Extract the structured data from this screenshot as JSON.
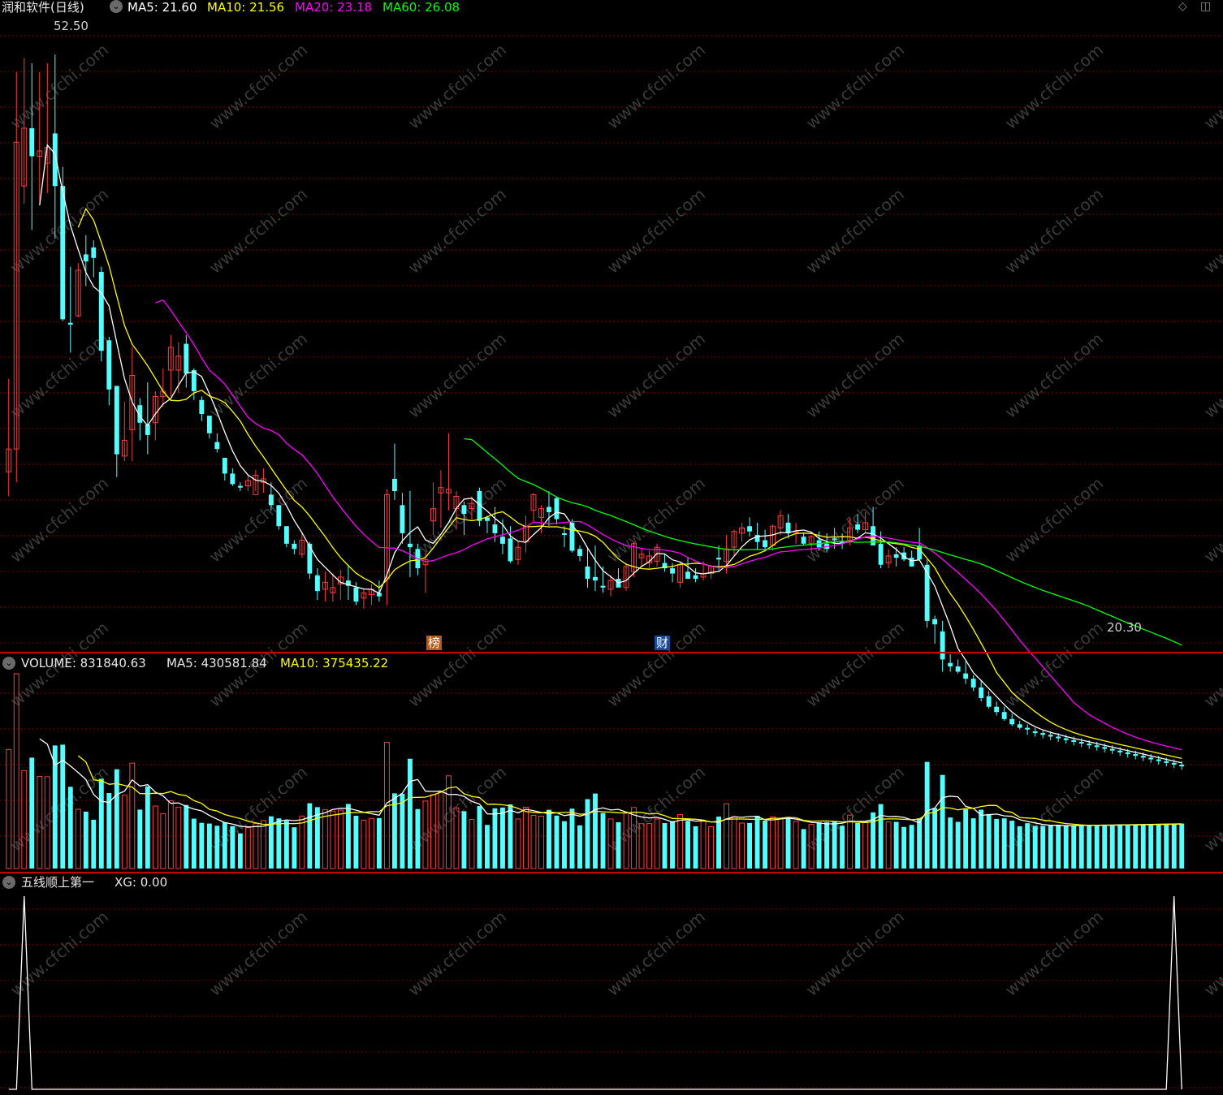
{
  "header": {
    "stock_name": "润和软件(日线)",
    "ma5": "MA5: 21.60",
    "ma10": "MA10: 21.56",
    "ma20": "MA20: 23.18",
    "ma60": "MA60: 26.08"
  },
  "volume_header": {
    "volume": "VOLUME: 831840.63",
    "ma5": "MA5: 430581.84",
    "ma10": "MA10: 375435.22"
  },
  "indicator_header": {
    "name": "五线顺上第一",
    "xg": "XG: 0.00"
  },
  "annotations": {
    "high_label": "52.50",
    "low_label": "20.30",
    "badge_bang": "榜",
    "badge_cai": "财"
  },
  "watermark": "www.cfchi.com",
  "colors": {
    "up": "#ff3c3c",
    "down": "#54ffff",
    "ma5": "#ffffff",
    "ma10": "#ffff00",
    "ma20": "#ff00ff",
    "ma60": "#00ff00",
    "grid": "#7a0000",
    "panel_border": "#c80000"
  },
  "icons": {
    "collapse": "chevron-down-circle-icon",
    "corner_left": "diamond-icon",
    "corner_right": "window-icon"
  },
  "chart_data": {
    "type": "candlestick",
    "price_range": [
      19.5,
      54.5
    ],
    "volume_range": [
      0,
      1050000
    ],
    "indicator_range": [
      0,
      1
    ],
    "candles": [
      {
        "o": 28.7,
        "h": 34,
        "l": 27.3,
        "c": 30
      },
      {
        "o": 30,
        "h": 51.5,
        "l": 28.1,
        "c": 47.5
      },
      {
        "o": 45,
        "h": 52.3,
        "l": 44,
        "c": 48.3
      },
      {
        "o": 48.3,
        "h": 52,
        "l": 42.5,
        "c": 46.7
      },
      {
        "o": 46.7,
        "h": 51.5,
        "l": 44.1,
        "c": 47
      },
      {
        "o": 46.3,
        "h": 52,
        "l": 44.6,
        "c": 47.2
      },
      {
        "o": 48,
        "h": 52.5,
        "l": 42,
        "c": 45
      },
      {
        "o": 45,
        "h": 46.1,
        "l": 37.3,
        "c": 37.4
      },
      {
        "o": 37.2,
        "h": 40.4,
        "l": 35.5,
        "c": 37.1
      },
      {
        "o": 37.6,
        "h": 40.6,
        "l": 37.5,
        "c": 40.2
      },
      {
        "o": 41.1,
        "h": 42.2,
        "l": 39.3,
        "c": 40.7
      },
      {
        "o": 41.5,
        "h": 41.9,
        "l": 39.8,
        "c": 40.9
      },
      {
        "o": 40.1,
        "h": 40.4,
        "l": 35,
        "c": 35.6
      },
      {
        "o": 36.2,
        "h": 36.4,
        "l": 32.5,
        "c": 33.4
      },
      {
        "o": 33.6,
        "h": 33.6,
        "l": 28.4,
        "c": 29.7
      },
      {
        "o": 29.6,
        "h": 32.7,
        "l": 29.3,
        "c": 30.5
      },
      {
        "o": 31.1,
        "h": 35.8,
        "l": 29.3,
        "c": 34.2
      },
      {
        "o": 32.5,
        "h": 32.9,
        "l": 30.5,
        "c": 31.5
      },
      {
        "o": 31.4,
        "h": 33.8,
        "l": 29.7,
        "c": 30.8
      },
      {
        "o": 31.5,
        "h": 33.3,
        "l": 30.5,
        "c": 33
      },
      {
        "o": 33,
        "h": 34.6,
        "l": 32.4,
        "c": 33.3
      },
      {
        "o": 34.5,
        "h": 36.5,
        "l": 33,
        "c": 35.8
      },
      {
        "o": 34.5,
        "h": 36.1,
        "l": 33.2,
        "c": 35.3
      },
      {
        "o": 36,
        "h": 36.5,
        "l": 33.5,
        "c": 34.3
      },
      {
        "o": 34.5,
        "h": 34.6,
        "l": 32.8,
        "c": 33.3
      },
      {
        "o": 32.8,
        "h": 33,
        "l": 31.6,
        "c": 32
      },
      {
        "o": 31.9,
        "h": 31.9,
        "l": 30.6,
        "c": 30.9
      },
      {
        "o": 30.4,
        "h": 30.9,
        "l": 29.8,
        "c": 30
      },
      {
        "o": 29.5,
        "h": 29.5,
        "l": 28.2,
        "c": 28.6
      },
      {
        "o": 28.6,
        "h": 28.9,
        "l": 27.9,
        "c": 28
      },
      {
        "o": 27.9,
        "h": 28.1,
        "l": 27.6,
        "c": 27.8
      },
      {
        "o": 27.9,
        "h": 28.5,
        "l": 27.6,
        "c": 28.2
      },
      {
        "o": 27.4,
        "h": 28.8,
        "l": 27.6,
        "c": 28.5
      },
      {
        "o": 28.1,
        "h": 28.9,
        "l": 27.5,
        "c": 28.3
      },
      {
        "o": 27.4,
        "h": 28.1,
        "l": 26.5,
        "c": 26.8
      },
      {
        "o": 26.8,
        "h": 26.8,
        "l": 25.4,
        "c": 25.6
      },
      {
        "o": 25.6,
        "h": 25.6,
        "l": 24.4,
        "c": 24.6
      },
      {
        "o": 24.6,
        "h": 24.8,
        "l": 24,
        "c": 24.3
      },
      {
        "o": 24,
        "h": 25.3,
        "l": 23.8,
        "c": 24.8
      },
      {
        "o": 24.6,
        "h": 24.7,
        "l": 22.6,
        "c": 22.9
      },
      {
        "o": 22.8,
        "h": 23.2,
        "l": 21.4,
        "c": 21.9
      },
      {
        "o": 22,
        "h": 23,
        "l": 21.3,
        "c": 22.4
      },
      {
        "o": 21.8,
        "h": 22.9,
        "l": 21.3,
        "c": 22.1
      },
      {
        "o": 22.3,
        "h": 23.1,
        "l": 21.4,
        "c": 22.7
      },
      {
        "o": 22.5,
        "h": 23.4,
        "l": 21.4,
        "c": 22.2
      },
      {
        "o": 22.1,
        "h": 22.4,
        "l": 21.1,
        "c": 21.3
      },
      {
        "o": 21.5,
        "h": 22,
        "l": 20.9,
        "c": 21.8
      },
      {
        "o": 21.7,
        "h": 22.3,
        "l": 21.1,
        "c": 22
      },
      {
        "o": 21.8,
        "h": 22.5,
        "l": 21.3,
        "c": 21.6
      },
      {
        "o": 22.6,
        "h": 27.7,
        "l": 21.1,
        "c": 27.4
      },
      {
        "o": 28.3,
        "h": 30.3,
        "l": 27.1,
        "c": 27.6
      },
      {
        "o": 26.8,
        "h": 27.5,
        "l": 24.6,
        "c": 25.2
      },
      {
        "o": 24.6,
        "h": 27.6,
        "l": 22.7,
        "c": 24.4
      },
      {
        "o": 24.3,
        "h": 24.6,
        "l": 22.8,
        "c": 23.2
      },
      {
        "o": 23.4,
        "h": 24.1,
        "l": 21.8,
        "c": 23.7
      },
      {
        "o": 25.9,
        "h": 28.1,
        "l": 25.1,
        "c": 26.6
      },
      {
        "o": 27.5,
        "h": 28.8,
        "l": 25.5,
        "c": 27.8
      },
      {
        "o": 27.5,
        "h": 30.9,
        "l": 26.5,
        "c": 27.7
      },
      {
        "o": 26.6,
        "h": 27.6,
        "l": 25.4,
        "c": 27.3
      },
      {
        "o": 26.8,
        "h": 27,
        "l": 25.1,
        "c": 26.3
      },
      {
        "o": 26.6,
        "h": 27.3,
        "l": 25.9,
        "c": 26.9
      },
      {
        "o": 27.6,
        "h": 27.8,
        "l": 25.6,
        "c": 25.9
      },
      {
        "o": 26.1,
        "h": 26.2,
        "l": 25.2,
        "c": 25.9
      },
      {
        "o": 25.7,
        "h": 26.7,
        "l": 24.7,
        "c": 25.2
      },
      {
        "o": 25,
        "h": 26,
        "l": 24,
        "c": 24.6
      },
      {
        "o": 24.9,
        "h": 25.6,
        "l": 23.5,
        "c": 23.6
      },
      {
        "o": 23.7,
        "h": 24.7,
        "l": 23.4,
        "c": 24.4
      },
      {
        "o": 24.7,
        "h": 26.2,
        "l": 24.1,
        "c": 25.6
      },
      {
        "o": 26.5,
        "h": 27.5,
        "l": 25.8,
        "c": 27.4
      },
      {
        "o": 26.1,
        "h": 26.8,
        "l": 25.2,
        "c": 26.6
      },
      {
        "o": 26.7,
        "h": 27.6,
        "l": 25.6,
        "c": 26.4
      },
      {
        "o": 27.2,
        "h": 27.3,
        "l": 25.7,
        "c": 26
      },
      {
        "o": 25.2,
        "h": 25.6,
        "l": 24.4,
        "c": 25.1
      },
      {
        "o": 25.8,
        "h": 26,
        "l": 24.1,
        "c": 24.2
      },
      {
        "o": 24.3,
        "h": 24.5,
        "l": 23.6,
        "c": 23.9
      },
      {
        "o": 23.3,
        "h": 24.4,
        "l": 22.1,
        "c": 22.6
      },
      {
        "o": 22.7,
        "h": 24.5,
        "l": 21.9,
        "c": 22.5
      },
      {
        "o": 22.2,
        "h": 23.3,
        "l": 21.8,
        "c": 22.1
      },
      {
        "o": 22,
        "h": 22.8,
        "l": 21.6,
        "c": 22.5
      },
      {
        "o": 22.6,
        "h": 23.2,
        "l": 22.2,
        "c": 22.1
      },
      {
        "o": 22.1,
        "h": 23.5,
        "l": 21.9,
        "c": 23.3
      },
      {
        "o": 23,
        "h": 24.7,
        "l": 22.7,
        "c": 24.6
      },
      {
        "o": 23.8,
        "h": 24.3,
        "l": 23.3,
        "c": 24
      },
      {
        "o": 23.5,
        "h": 24.2,
        "l": 23.2,
        "c": 23.9
      },
      {
        "o": 23.6,
        "h": 24.6,
        "l": 23.3,
        "c": 24.4
      },
      {
        "o": 23.5,
        "h": 24,
        "l": 23,
        "c": 23.2
      },
      {
        "o": 23.2,
        "h": 23.5,
        "l": 22.4,
        "c": 22.9
      },
      {
        "o": 22.4,
        "h": 23.6,
        "l": 22.1,
        "c": 23.4
      },
      {
        "o": 23,
        "h": 23.8,
        "l": 22.7,
        "c": 22.6
      },
      {
        "o": 22.8,
        "h": 23.2,
        "l": 22.4,
        "c": 22.6
      },
      {
        "o": 22.7,
        "h": 23.6,
        "l": 22.5,
        "c": 22.9
      },
      {
        "o": 22.9,
        "h": 23.4,
        "l": 22.6,
        "c": 23.3
      },
      {
        "o": 23.8,
        "h": 24.5,
        "l": 23.1,
        "c": 23.7
      },
      {
        "o": 23.6,
        "h": 25.1,
        "l": 22.9,
        "c": 24.3
      },
      {
        "o": 24.4,
        "h": 25.4,
        "l": 23.9,
        "c": 25.3
      },
      {
        "o": 25.2,
        "h": 25.8,
        "l": 24.7,
        "c": 25.5
      },
      {
        "o": 25.6,
        "h": 26.1,
        "l": 25,
        "c": 25.3
      },
      {
        "o": 25.1,
        "h": 25.8,
        "l": 24.3,
        "c": 24.7
      },
      {
        "o": 24.8,
        "h": 25.4,
        "l": 24.2,
        "c": 24.4
      },
      {
        "o": 24.5,
        "h": 25.7,
        "l": 24.2,
        "c": 25.6
      },
      {
        "o": 25.5,
        "h": 26.5,
        "l": 25.1,
        "c": 26.2
      },
      {
        "o": 25.8,
        "h": 26.3,
        "l": 24.9,
        "c": 25.2
      },
      {
        "o": 25.3,
        "h": 25.8,
        "l": 24.6,
        "c": 25.3
      },
      {
        "o": 25,
        "h": 25.2,
        "l": 24.5,
        "c": 24.6
      },
      {
        "o": 24.6,
        "h": 25.1,
        "l": 24.1,
        "c": 25
      },
      {
        "o": 24.8,
        "h": 25.3,
        "l": 24.2,
        "c": 24.4
      },
      {
        "o": 24.6,
        "h": 25.2,
        "l": 24.1,
        "c": 24.3
      },
      {
        "o": 24.9,
        "h": 25.5,
        "l": 24.3,
        "c": 24.8
      },
      {
        "o": 24.7,
        "h": 25.2,
        "l": 24.3,
        "c": 24.6
      },
      {
        "o": 24.8,
        "h": 26.1,
        "l": 24.5,
        "c": 25.5
      },
      {
        "o": 25.7,
        "h": 26.3,
        "l": 25.2,
        "c": 25.4
      },
      {
        "o": 25.4,
        "h": 26.4,
        "l": 25.2,
        "c": 25.8
      },
      {
        "o": 25.6,
        "h": 26.7,
        "l": 25,
        "c": 24.5
      },
      {
        "o": 24.6,
        "h": 25.3,
        "l": 23.2,
        "c": 23.4
      },
      {
        "o": 23.5,
        "h": 24.3,
        "l": 23.2,
        "c": 23.9
      },
      {
        "o": 24,
        "h": 24.4,
        "l": 23.3,
        "c": 23.8
      },
      {
        "o": 24.1,
        "h": 24.4,
        "l": 23.6,
        "c": 23.7
      },
      {
        "o": 23.8,
        "h": 24.2,
        "l": 23.3,
        "c": 23.3
      },
      {
        "o": 24.5,
        "h": 25.5,
        "l": 24.2,
        "c": 23.7
      },
      {
        "o": 23.4,
        "h": 23.7,
        "l": 19.8,
        "c": 20.2
      },
      {
        "o": 20.3,
        "h": 20.5,
        "l": 18.9,
        "c": 20
      },
      {
        "o": 19.6,
        "h": 20.2,
        "l": 17.3,
        "c": 18
      },
      {
        "o": 17.8,
        "h": 18.3,
        "l": 17.3,
        "c": 17.6
      },
      {
        "o": 17.6,
        "h": 18,
        "l": 17.2,
        "c": 17.3
      },
      {
        "o": 17.2,
        "h": 17.9,
        "l": 16.6,
        "c": 16.9
      },
      {
        "o": 16.9,
        "h": 17.1,
        "l": 16.2,
        "c": 16.4
      },
      {
        "o": 16.4,
        "h": 16.8,
        "l": 15.6,
        "c": 15.8
      },
      {
        "o": 15.9,
        "h": 16.2,
        "l": 15.2,
        "c": 15.3
      },
      {
        "o": 15.3,
        "h": 15.6,
        "l": 14.8,
        "c": 15
      },
      {
        "o": 15,
        "h": 15.3,
        "l": 14.5,
        "c": 14.6
      },
      {
        "o": 14.6,
        "h": 14.9,
        "l": 14.2,
        "c": 14.3
      },
      {
        "o": 14.3,
        "h": 14.5,
        "l": 14,
        "c": 14.1
      },
      {
        "o": 14.1,
        "h": 14.3,
        "l": 13.7,
        "c": 14
      },
      {
        "o": 13.9,
        "h": 14.1,
        "l": 13.6,
        "c": 13.8
      },
      {
        "o": 13.8,
        "h": 14,
        "l": 13.5,
        "c": 13.7
      },
      {
        "o": 13.7,
        "h": 13.9,
        "l": 13.4,
        "c": 13.6
      },
      {
        "o": 13.6,
        "h": 13.8,
        "l": 13.3,
        "c": 13.5
      },
      {
        "o": 13.5,
        "h": 13.7,
        "l": 13.2,
        "c": 13.4
      },
      {
        "o": 13.4,
        "h": 13.6,
        "l": 13.1,
        "c": 13.3
      },
      {
        "o": 13.3,
        "h": 13.5,
        "l": 13,
        "c": 13.2
      },
      {
        "o": 13.2,
        "h": 13.4,
        "l": 12.9,
        "c": 13.1
      },
      {
        "o": 13.1,
        "h": 13.3,
        "l": 12.8,
        "c": 13
      },
      {
        "o": 13,
        "h": 13.2,
        "l": 12.7,
        "c": 12.9
      },
      {
        "o": 12.9,
        "h": 13.1,
        "l": 12.6,
        "c": 12.8
      },
      {
        "o": 12.8,
        "h": 13,
        "l": 12.5,
        "c": 12.7
      },
      {
        "o": 12.7,
        "h": 12.9,
        "l": 12.4,
        "c": 12.6
      },
      {
        "o": 12.6,
        "h": 12.8,
        "l": 12.3,
        "c": 12.5
      },
      {
        "o": 12.5,
        "h": 12.7,
        "l": 12.2,
        "c": 12.4
      },
      {
        "o": 12.4,
        "h": 12.6,
        "l": 12.1,
        "c": 12.3
      },
      {
        "o": 12.3,
        "h": 12.5,
        "l": 12,
        "c": 12.2
      },
      {
        "o": 12.2,
        "h": 12.4,
        "l": 11.9,
        "c": 12.1
      },
      {
        "o": 12.1,
        "h": 12.3,
        "l": 11.8,
        "c": 12
      },
      {
        "o": 12,
        "h": 12.2,
        "l": 11.7,
        "c": 11.9
      }
    ],
    "volumes": [],
    "indicator_spikes": [
      2,
      151
    ],
    "ma_lines": [
      "ma5",
      "ma10",
      "ma20",
      "ma60"
    ]
  }
}
